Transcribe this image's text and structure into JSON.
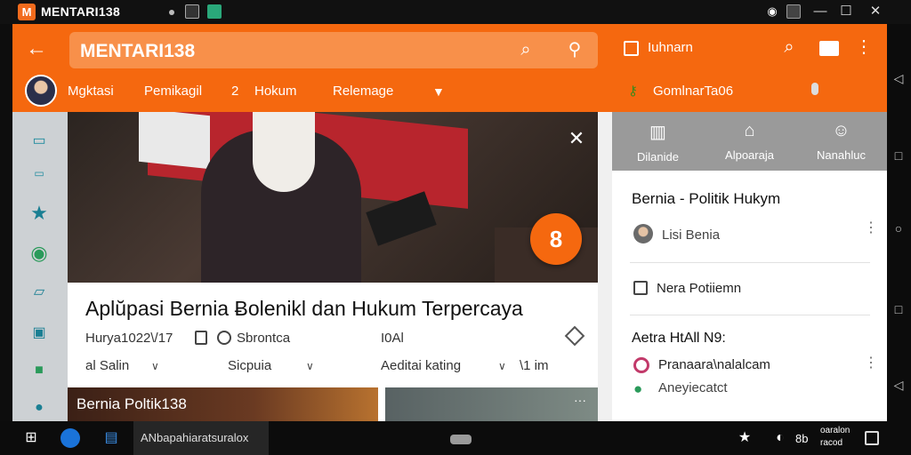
{
  "window": {
    "title": "MENTARI138",
    "logo_letter": "M",
    "controls": {
      "minimize": "—",
      "maximize": "☐",
      "close": "✕"
    }
  },
  "header": {
    "search_value": "MENTARI138",
    "right_label": "Iuhnarn",
    "nav": [
      "Mgktasi",
      "Pemikagil",
      "2",
      "Hokum",
      "Relemage"
    ],
    "user_label": "GomlnarTa06"
  },
  "hero": {
    "fab_label": "8"
  },
  "article": {
    "title": "Aplŭpasi Bernia Ƀolenikl dan Hukum Terpercaya",
    "meta1": "Hurya1022\\/17",
    "meta2": "Sbrontca",
    "meta3": "I0Al",
    "filter1": "al Salin",
    "filter2": "Sicpuia",
    "filter3": "Aeditai kating",
    "filter4": "\\1 im"
  },
  "thumbs": {
    "caption": "Bernia  Poltik138"
  },
  "right_panel": {
    "tabs": [
      {
        "label": "Dilanide",
        "icon": "columns-icon"
      },
      {
        "label": "Alpoaraja",
        "icon": "home-icon"
      },
      {
        "label": "Nanahluc",
        "icon": "people-icon"
      }
    ],
    "section_title": "Bernia - Politik Hukym",
    "author": "Lisi Benia",
    "item1": "Nera Potiiemn",
    "section2_title": "Aetra HtAll N9:",
    "item2": "Pranaara\\nalalcam",
    "item3": "Aneyiecatct"
  },
  "taskbar": {
    "app_label": "ANbapahiaratsuralox",
    "num": "8b",
    "clock_top": "oaralon",
    "clock_bottom": "racod"
  },
  "colors": {
    "accent": "#f5680f",
    "search_bg": "#f8904a",
    "sidebar_bg": "#cdd1d4",
    "tabs_bg": "#9a9a9a"
  }
}
